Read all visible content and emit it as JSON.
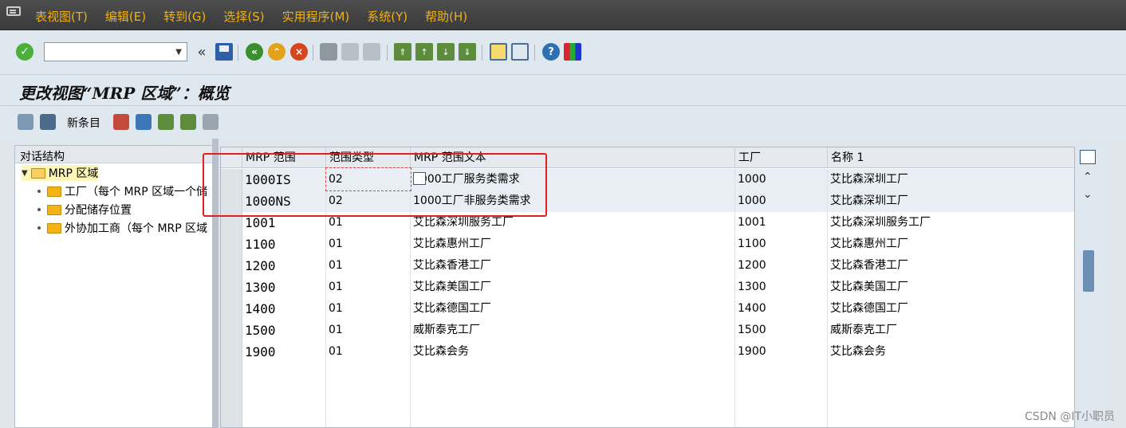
{
  "menu": {
    "items": [
      "表视图(T)",
      "编辑(E)",
      "转到(G)",
      "选择(S)",
      "实用程序(M)",
      "系统(Y)",
      "帮助(H)"
    ]
  },
  "toolbar": {
    "command_value": "",
    "chevron": "«"
  },
  "title": "更改视图“MRP 区域”：概览",
  "app_toolbar": {
    "new_entries": "新条目"
  },
  "tree": {
    "header": "对话结构",
    "root": "MRP 区域",
    "children": [
      "工厂（每个 MRP 区域一个储",
      "分配储存位置",
      "外协加工商（每个 MRP 区域"
    ]
  },
  "grid": {
    "columns": [
      "MRP 范围",
      "范围类型",
      "MRP 范围文本",
      "工厂",
      "名称 1"
    ],
    "rows": [
      [
        "1000IS",
        "02",
        "1000工厂服务类需求",
        "1000",
        "艾比森深圳工厂"
      ],
      [
        "1000NS",
        "02",
        "1000工厂非服务类需求",
        "1000",
        "艾比森深圳工厂"
      ],
      [
        "1001",
        "01",
        "艾比森深圳服务工厂",
        "1001",
        "艾比森深圳服务工厂"
      ],
      [
        "1100",
        "01",
        "艾比森惠州工厂",
        "1100",
        "艾比森惠州工厂"
      ],
      [
        "1200",
        "01",
        "艾比森香港工厂",
        "1200",
        "艾比森香港工厂"
      ],
      [
        "1300",
        "01",
        "艾比森美国工厂",
        "1300",
        "艾比森美国工厂"
      ],
      [
        "1400",
        "01",
        "艾比森德国工厂",
        "1400",
        "艾比森德国工厂"
      ],
      [
        "1500",
        "01",
        "威斯泰克工厂",
        "1500",
        "威斯泰克工厂"
      ],
      [
        "1900",
        "01",
        "艾比森会务",
        "1900",
        "艾比森会务"
      ]
    ]
  },
  "watermark": "CSDN @IT小职员"
}
